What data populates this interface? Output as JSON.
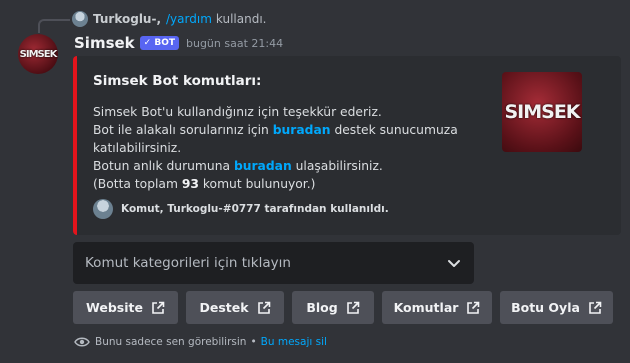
{
  "reply": {
    "username": "Turkoglu-,",
    "command": "/yardım",
    "action_text": "kullandı."
  },
  "message": {
    "author": "Simsek",
    "bot_badge": "✓ BOT",
    "timestamp": "bugün saat 21:44",
    "avatar_logo_text": "SIMSEK"
  },
  "embed": {
    "accent_color": "#e3141c",
    "title": "Simsek Bot komutları:",
    "line1": "Simsek Bot'u kullandığınız için teşekkür ederiz.",
    "line2_prefix": "Bot ile alakalı sorularınız için ",
    "line2_link": "buradan",
    "line2_suffix": " destek sunucumuza katılabilirsiniz.",
    "line3_prefix": "Botun anlık durumuna ",
    "line3_link": "buradan",
    "line3_suffix": " ulaşabilirsiniz.",
    "line4_prefix": "(Botta toplam ",
    "line4_count": "93",
    "line4_suffix": " komut bulunuyor.)",
    "thumbnail_logo_text": "SIMSEK",
    "footer_text": "Komut, Turkoglu-#0777 tarafından kullanıldı."
  },
  "select_menu": {
    "placeholder": "Komut kategorileri için tıklayın"
  },
  "buttons": [
    {
      "label": "Website"
    },
    {
      "label": "Destek"
    },
    {
      "label": "Blog"
    },
    {
      "label": "Komutlar"
    },
    {
      "label": "Botu Oyla"
    }
  ],
  "ephemeral": {
    "notice": "Bunu sadece sen görebilirsin",
    "separator": "•",
    "dismiss": "Bu mesajı sil"
  },
  "colors": {
    "background": "#313338",
    "embed_background": "#2b2d31",
    "link": "#00a8fc",
    "button": "#4e5058",
    "bot_badge": "#5865f2"
  },
  "icons": [
    "reply-avatar-icon",
    "bot-avatar",
    "verified-check-icon",
    "chevron-down-icon",
    "external-link-icon",
    "eye-icon"
  ]
}
